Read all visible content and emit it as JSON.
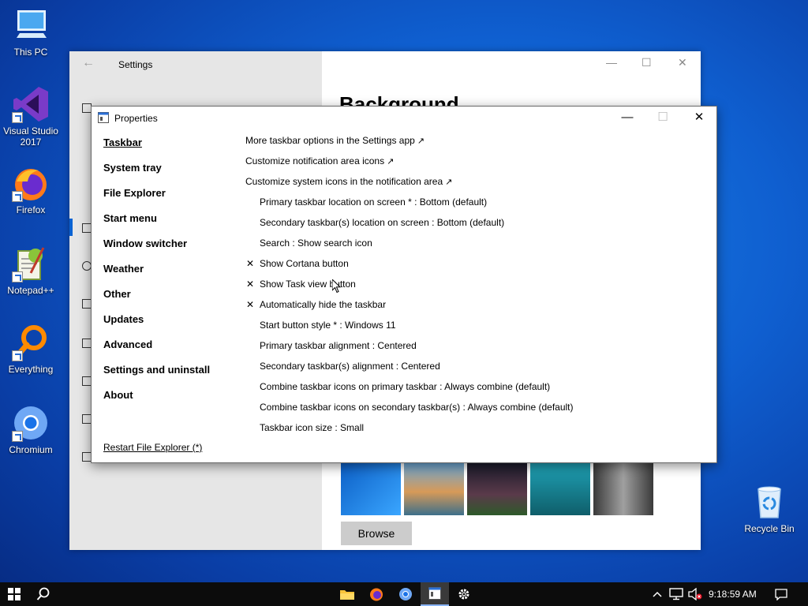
{
  "desktop": {
    "icons": [
      {
        "label": "This PC",
        "icon": "computer-icon"
      },
      {
        "label": "Visual Studio 2017",
        "icon": "visual-studio-icon"
      },
      {
        "label": "Firefox",
        "icon": "firefox-icon"
      },
      {
        "label": "Notepad++",
        "icon": "notepadpp-icon"
      },
      {
        "label": "Everything",
        "icon": "everything-search-icon"
      },
      {
        "label": "Chromium",
        "icon": "chromium-icon"
      },
      {
        "label": "Recycle Bin",
        "icon": "recycle-bin-icon"
      }
    ]
  },
  "settings": {
    "title": "Settings",
    "heading": "Background",
    "browse_label": "Browse",
    "thumb_colors": [
      "#1a78d8",
      "#c48a4a",
      "#2d2a3a",
      "#1f8aa0",
      "#7b7b7b"
    ]
  },
  "properties": {
    "title": "Properties",
    "nav": [
      {
        "label": "Taskbar",
        "active": true
      },
      {
        "label": "System tray"
      },
      {
        "label": "File Explorer"
      },
      {
        "label": "Start menu"
      },
      {
        "label": "Window switcher"
      },
      {
        "label": "Weather"
      },
      {
        "label": "Other"
      },
      {
        "label": "Updates"
      },
      {
        "label": "Advanced"
      },
      {
        "label": "Settings and uninstall"
      },
      {
        "label": "About"
      }
    ],
    "restart_label": "Restart File Explorer (*)",
    "options": [
      {
        "kind": "link",
        "label": "More taskbar options in the Settings app"
      },
      {
        "kind": "link",
        "label": "Customize notification area icons"
      },
      {
        "kind": "link",
        "label": "Customize system icons in the notification area"
      },
      {
        "kind": "setting",
        "label": "Primary taskbar location on screen * : Bottom (default)"
      },
      {
        "kind": "setting",
        "label": "Secondary taskbar(s) location on screen : Bottom (default)"
      },
      {
        "kind": "setting",
        "label": "Search : Show search icon"
      },
      {
        "kind": "setting",
        "label": "Show Cortana button",
        "mark": "✕"
      },
      {
        "kind": "setting",
        "label": "Show Task view button",
        "mark": "✕"
      },
      {
        "kind": "setting",
        "label": "Automatically hide the taskbar",
        "mark": "✕"
      },
      {
        "kind": "setting",
        "label": "Start button style * : Windows 11"
      },
      {
        "kind": "setting",
        "label": "Primary taskbar alignment : Centered"
      },
      {
        "kind": "setting",
        "label": "Secondary taskbar(s) alignment : Centered"
      },
      {
        "kind": "setting",
        "label": "Combine taskbar icons on primary taskbar : Always combine (default)"
      },
      {
        "kind": "setting",
        "label": "Combine taskbar icons on secondary taskbar(s) : Always combine (default)"
      },
      {
        "kind": "setting",
        "label": "Taskbar icon size : Small"
      }
    ],
    "external_glyph": "↗"
  },
  "taskbar": {
    "clock": "9:18:59 AM",
    "apps": [
      "file-explorer-icon",
      "firefox-icon",
      "chromium-icon",
      "properties-app-icon",
      "settings-gear-icon"
    ]
  }
}
